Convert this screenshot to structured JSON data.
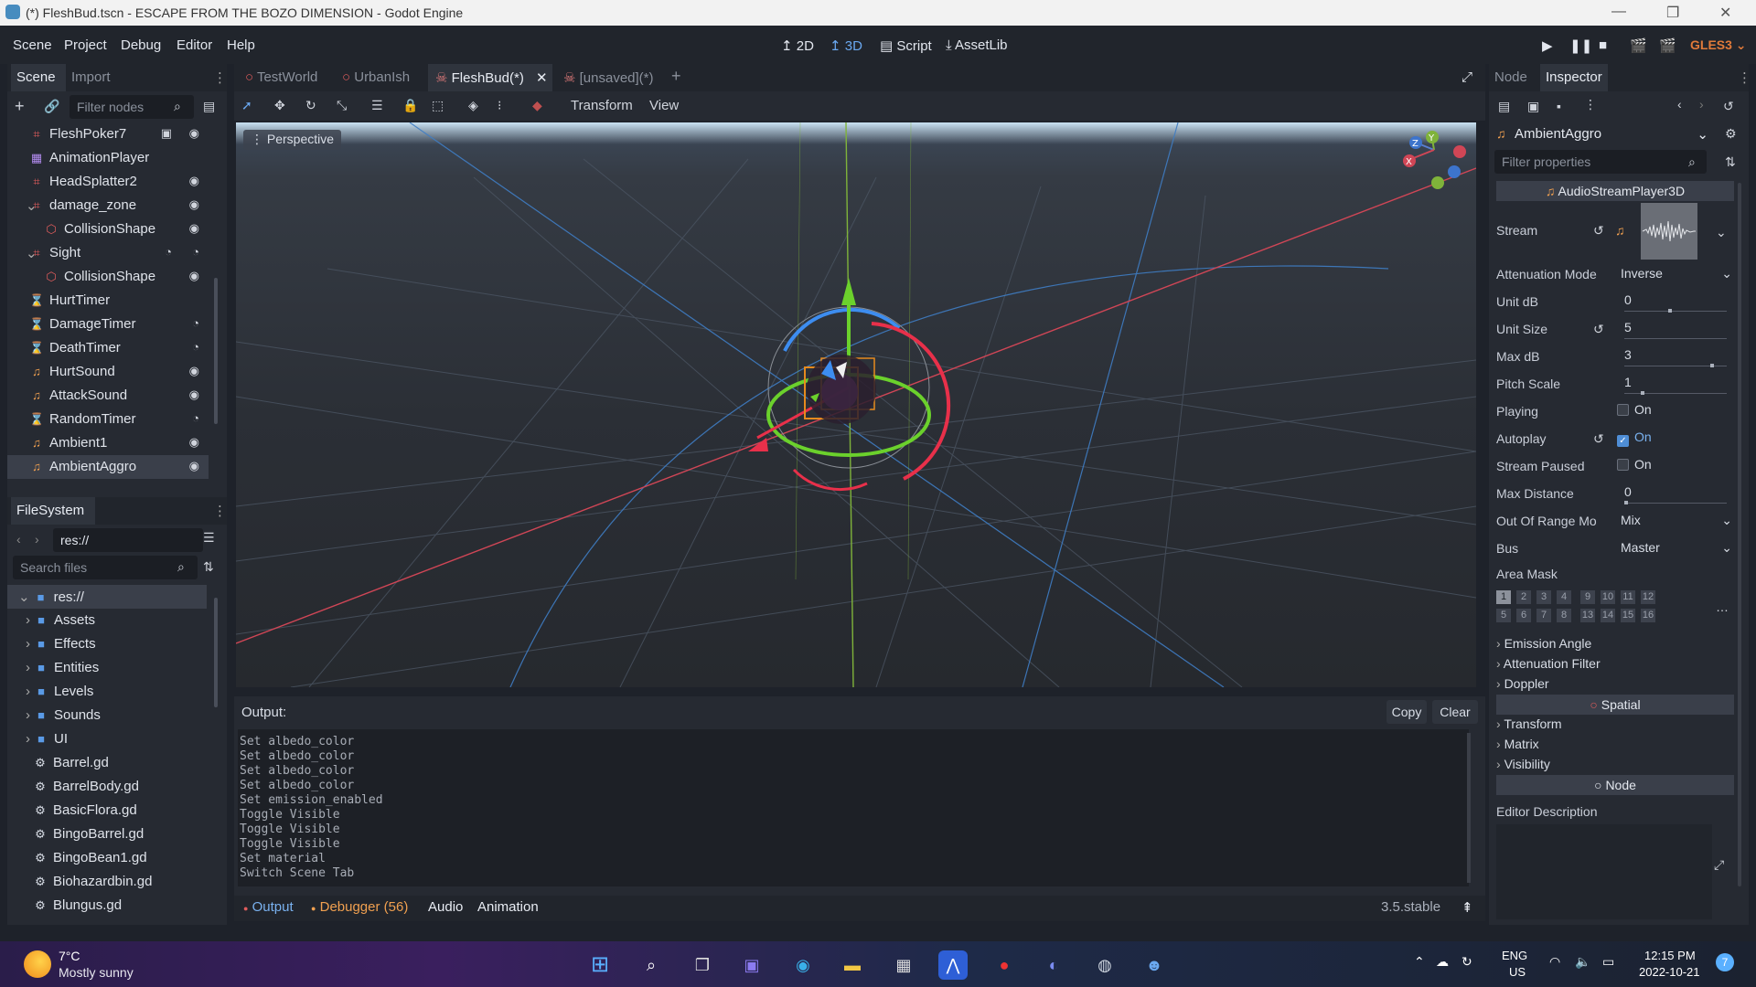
{
  "window": {
    "title": "(*) FleshBud.tscn - ESCAPE FROM THE BOZO DIMENSION - Godot Engine"
  },
  "menu": [
    "Scene",
    "Project",
    "Debug",
    "Editor",
    "Help"
  ],
  "modes": [
    "2D",
    "3D",
    "Script",
    "AssetLib"
  ],
  "renderer": "GLES3",
  "scene_dock": {
    "tabs": [
      "Scene",
      "Import"
    ],
    "filter_placeholder": "Filter nodes",
    "nodes": [
      {
        "name": "FleshPoker7",
        "icon": "mesh-icon",
        "indent": 0
      },
      {
        "name": "AnimationPlayer",
        "icon": "animation-icon",
        "indent": 0
      },
      {
        "name": "HeadSplatter2",
        "icon": "mesh-icon",
        "indent": 0
      },
      {
        "name": "damage_zone",
        "icon": "area-icon",
        "indent": 0
      },
      {
        "name": "CollisionShape",
        "icon": "collision-icon",
        "indent": 1
      },
      {
        "name": "Sight",
        "icon": "area-icon",
        "indent": 0
      },
      {
        "name": "CollisionShape",
        "icon": "collision-icon",
        "indent": 1
      },
      {
        "name": "HurtTimer",
        "icon": "timer-icon",
        "indent": 0
      },
      {
        "name": "DamageTimer",
        "icon": "timer-icon",
        "indent": 0
      },
      {
        "name": "DeathTimer",
        "icon": "timer-icon",
        "indent": 0
      },
      {
        "name": "HurtSound",
        "icon": "audio-icon",
        "indent": 0
      },
      {
        "name": "AttackSound",
        "icon": "audio-icon",
        "indent": 0
      },
      {
        "name": "RandomTimer",
        "icon": "timer-icon",
        "indent": 0
      },
      {
        "name": "Ambient1",
        "icon": "audio-icon",
        "indent": 0
      },
      {
        "name": "AmbientAggro",
        "icon": "audio-icon",
        "indent": 0
      }
    ]
  },
  "filesystem": {
    "title": "FileSystem",
    "path": "res://",
    "search_placeholder": "Search files",
    "items": [
      {
        "name": "res://",
        "type": "folder"
      },
      {
        "name": "Assets",
        "type": "folder"
      },
      {
        "name": "Effects",
        "type": "folder"
      },
      {
        "name": "Entities",
        "type": "folder"
      },
      {
        "name": "Levels",
        "type": "folder"
      },
      {
        "name": "Sounds",
        "type": "folder"
      },
      {
        "name": "UI",
        "type": "folder"
      },
      {
        "name": "Barrel.gd",
        "type": "script"
      },
      {
        "name": "BarrelBody.gd",
        "type": "script"
      },
      {
        "name": "BasicFlora.gd",
        "type": "script"
      },
      {
        "name": "BingoBarrel.gd",
        "type": "script"
      },
      {
        "name": "BingoBean1.gd",
        "type": "script"
      },
      {
        "name": "Biohazardbin.gd",
        "type": "script"
      },
      {
        "name": "Blungus.gd",
        "type": "script"
      }
    ]
  },
  "editor_tabs": [
    "TestWorld",
    "UrbanIsh",
    "FleshBud(*)",
    "[unsaved](*)"
  ],
  "viewport": {
    "menus": [
      "Transform",
      "View"
    ],
    "label": "Perspective"
  },
  "output": {
    "title": "Output:",
    "copy": "Copy",
    "clear": "Clear",
    "lines": [
      "Set albedo_color",
      "Set albedo_color",
      "Set albedo_color",
      "Set albedo_color",
      "Set emission_enabled",
      "Toggle Visible",
      "Toggle Visible",
      "Toggle Visible",
      "Set material",
      "Switch Scene Tab"
    ],
    "bottom_tabs": [
      "Output",
      "Debugger (56)",
      "Audio",
      "Animation"
    ],
    "version": "3.5.stable"
  },
  "inspector": {
    "tabs": [
      "Node",
      "Inspector"
    ],
    "object": "AmbientAggro",
    "filter_placeholder": "Filter properties",
    "class": "AudioStreamPlayer3D",
    "props": {
      "stream": "Stream",
      "attenuation_mode": {
        "label": "Attenuation Mode",
        "value": "Inverse"
      },
      "unit_db": {
        "label": "Unit dB",
        "value": "0"
      },
      "unit_size": {
        "label": "Unit Size",
        "value": "5"
      },
      "max_db": {
        "label": "Max dB",
        "value": "3"
      },
      "pitch_scale": {
        "label": "Pitch Scale",
        "value": "1"
      },
      "playing": {
        "label": "Playing",
        "value": "On"
      },
      "autoplay": {
        "label": "Autoplay",
        "value": "On"
      },
      "stream_paused": {
        "label": "Stream Paused",
        "value": "On"
      },
      "max_distance": {
        "label": "Max Distance",
        "value": "0"
      },
      "out_of_range": {
        "label": "Out Of Range Mo",
        "value": "Mix"
      },
      "bus": {
        "label": "Bus",
        "value": "Master"
      },
      "area_mask": "Area Mask"
    },
    "area_mask_bits": [
      "1",
      "2",
      "3",
      "4",
      "9",
      "10",
      "11",
      "12",
      "5",
      "6",
      "7",
      "8",
      "13",
      "14",
      "15",
      "16"
    ],
    "groups1": [
      "Emission Angle",
      "Attenuation Filter",
      "Doppler"
    ],
    "spatial": "Spatial",
    "groups2": [
      "Transform",
      "Matrix",
      "Visibility"
    ],
    "node": "Node",
    "editor_description": "Editor Description"
  },
  "taskbar": {
    "temp": "7°C",
    "weather": "Mostly sunny",
    "lang1": "ENG",
    "lang2": "US",
    "time": "12:15 PM",
    "date": "2022-10-21",
    "badge": "7"
  }
}
